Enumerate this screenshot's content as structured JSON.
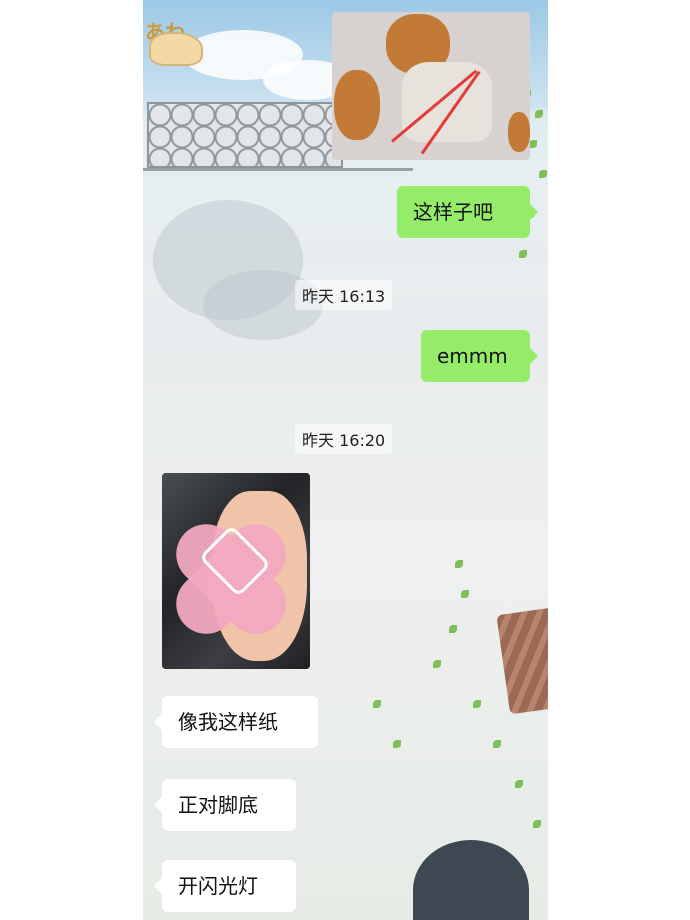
{
  "chat": {
    "messages": [
      {
        "type": "image",
        "direction": "out",
        "subject": "dog photo collage"
      },
      {
        "type": "text",
        "direction": "out",
        "text": "这样子吧"
      },
      {
        "type": "time",
        "text": "昨天 16:13"
      },
      {
        "type": "text",
        "direction": "out",
        "text": "emmm"
      },
      {
        "type": "time",
        "text": "昨天 16:20"
      },
      {
        "type": "image",
        "direction": "in",
        "subject": "foot photo with sticker"
      },
      {
        "type": "text",
        "direction": "in",
        "text": "像我这样纸"
      },
      {
        "type": "text",
        "direction": "in",
        "text": "正对脚底"
      },
      {
        "type": "text",
        "direction": "in",
        "text": "开闪光灯"
      }
    ]
  },
  "colors": {
    "outgoing_bubble": "#95ec69",
    "incoming_bubble": "#ffffff",
    "timestamp_bg": "rgba(255,255,255,0.55)"
  }
}
